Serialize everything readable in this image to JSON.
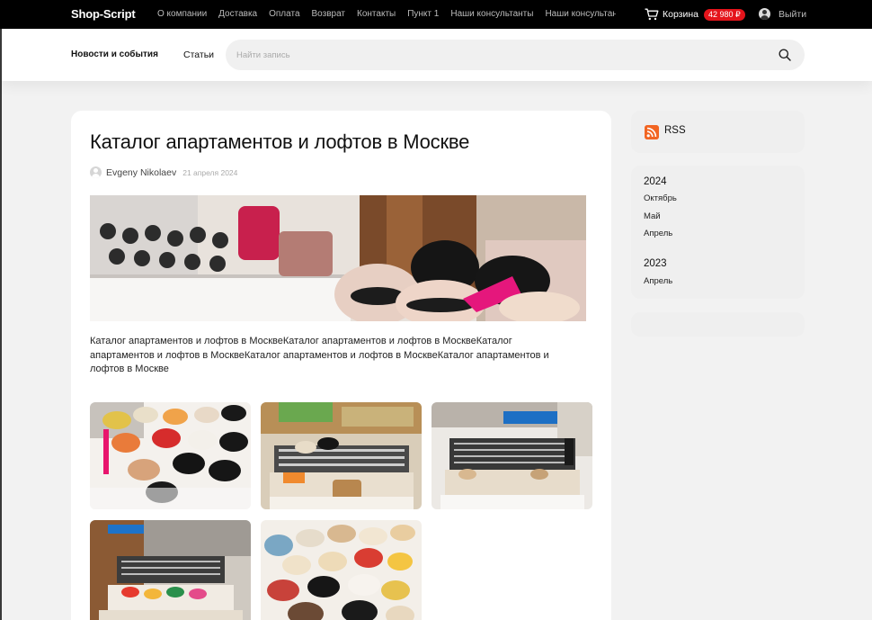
{
  "topbar": {
    "logo": "Shop-Script",
    "nav": [
      "О компании",
      "Доставка",
      "Оплата",
      "Возврат",
      "Контакты",
      "Пункт 1",
      "Наши консультанты",
      "Наши консультанты"
    ],
    "cart_label": "Корзина",
    "cart_total": "42 980 ₽",
    "login_label": "Выйти"
  },
  "header": {
    "nav_news": "Новости и события",
    "nav_articles": "Статьи",
    "search_placeholder": "Найти запись"
  },
  "post": {
    "title": "Каталог апартаментов и лофтов в Москве",
    "author": "Evgeny Nikolaev",
    "date": "21 апреля 2024",
    "text": "Каталог апартаментов и лофтов в МосквеКаталог апартаментов и лофтов в МосквеКаталог апартаментов и лофтов в МосквеКаталог апартаментов и лофтов в МосквеКаталог апартаментов и лофтов в Москве"
  },
  "sidebar": {
    "rss_label": "RSS",
    "archive": [
      {
        "year": "2024",
        "months": [
          "Октябрь",
          "Май",
          "Апрель"
        ]
      },
      {
        "year": "2023",
        "months": [
          "Апрель"
        ]
      }
    ]
  },
  "icons": {
    "cart": "cart-icon",
    "user": "user-icon",
    "search": "search-icon",
    "rss": "rss-icon"
  },
  "colors": {
    "topbar_bg": "#000000",
    "cart_badge": "#e4141b",
    "rss": "#f26522",
    "page_bg": "#f2f2f2"
  }
}
